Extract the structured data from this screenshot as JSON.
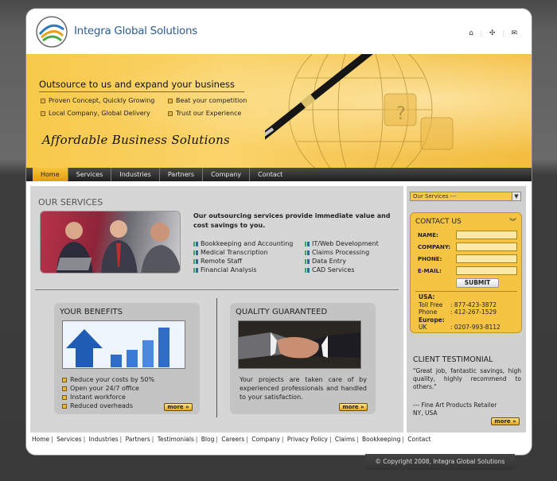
{
  "brand": {
    "name": "Integra Global Solutions"
  },
  "top_icons": [
    "home-icon",
    "sitemap-icon",
    "mail-icon"
  ],
  "hero": {
    "title": "Outsource to us and expand your business",
    "bullets": [
      "Proven Concept, Quickly Growing",
      "Beat your competition",
      "Local Company, Global Delivery",
      "Trust our Experience"
    ],
    "tagline": "Affordable Business Solutions"
  },
  "nav": [
    "Home",
    "Services",
    "Industries",
    "Partners",
    "Company",
    "Contact"
  ],
  "services": {
    "title": "OUR SERVICES",
    "intro": "Our outsourcing services provide immediate value and cost savings to you.",
    "col1": [
      "Bookkeeping and Accounting",
      "Medical Transcription",
      "Remote Staff",
      "Financial Analysis"
    ],
    "col2": [
      "IT/Web Development",
      "Claims Processing",
      "Data Entry",
      "CAD Services"
    ]
  },
  "benefits": {
    "title": "YOUR BENEFITS",
    "items": [
      "Reduce your costs by 50%",
      "Open your 24/7 office",
      "Instant workforce",
      "Reduced overheads"
    ],
    "more": "more »"
  },
  "quality": {
    "title": "QUALITY GUARANTEED",
    "text": "Your projects are taken care of by experienced professionals and handled to your satisfaction.",
    "more": "more »"
  },
  "side": {
    "select": "Our Services ---",
    "contact": {
      "title": "CONTACT US",
      "labels": [
        "NAME:",
        "COMPANY:",
        "PHONE:",
        "E-MAIL:"
      ],
      "submit": "SUBMIT",
      "usa_label": "USA:",
      "toll_free_label": "Toll Free",
      "toll_free": ": 877-423-3872",
      "phone_label": "Phone",
      "phone": ": 412-267-1529",
      "europe_label": "Europe:",
      "uk_label": "UK",
      "uk": ": 0207-993-8112"
    },
    "testimonial": {
      "title": "CLIENT TESTIMONIAL",
      "text": "\"Great job, fantastic savings, high quality, highly recommend to others.\"",
      "author": "--- Fine Art Products Retailer",
      "location": "NY, USA",
      "more": "more »"
    }
  },
  "footer_links": [
    "Home",
    "Services",
    "Industries",
    "Partners",
    "Testimonials",
    "Blog",
    "Careers",
    "Company",
    "Privacy Policy",
    "Claims",
    "Bookkeeping",
    "Contact"
  ],
  "copyright": "© Copyright 2008, Integra Global Solutions",
  "colors": {
    "accent": "#f5c443",
    "brand_blue": "#2a5e94",
    "nav_dark": "#1e1e1e"
  }
}
